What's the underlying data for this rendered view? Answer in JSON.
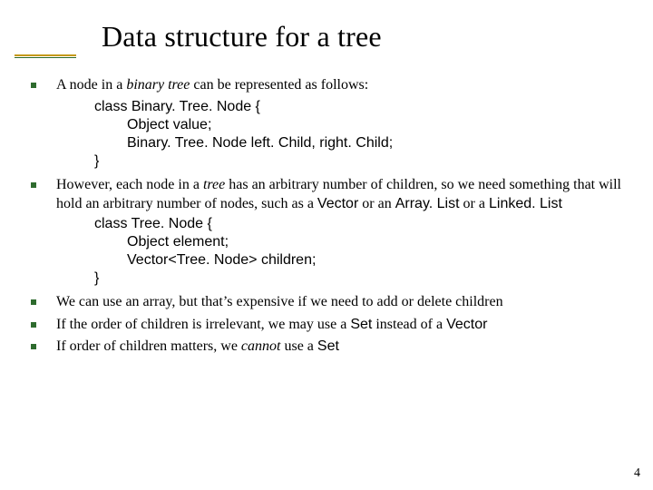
{
  "title": "Data structure for a tree",
  "bullets": {
    "b1": {
      "pre": "A node in a ",
      "ital": "binary tree",
      "post": " can be represented as follows:"
    },
    "code1": {
      "l1": "class Binary. Tree. Node {",
      "l2": "Object value;",
      "l3": "Binary. Tree. Node left. Child, right. Child;",
      "l4": "}"
    },
    "b2": {
      "pre": "However, each node in a ",
      "ital": "tree",
      "mid": " has an arbitrary number of children, so we need something that will hold an arbitrary number of nodes, such as a ",
      "s1": "Vector",
      "or1": " or an ",
      "s2": "Array. List",
      "or2": " or a ",
      "s3": "Linked. List"
    },
    "code2": {
      "l1": "class Tree. Node {",
      "l2": "Object element;",
      "l3": "Vector<Tree. Node> children;",
      "l4": "}"
    },
    "b3": "We can use an array, but that’s expensive if we need to add or delete children",
    "b4": {
      "pre": "If the order of children is irrelevant, we may use a ",
      "s1": "Set",
      "mid": " instead of a ",
      "s2": "Vector"
    },
    "b5": {
      "pre": "If order of children matters, we ",
      "ital": "cannot",
      "mid": " use a ",
      "s1": "Set"
    }
  },
  "page_number": "4"
}
